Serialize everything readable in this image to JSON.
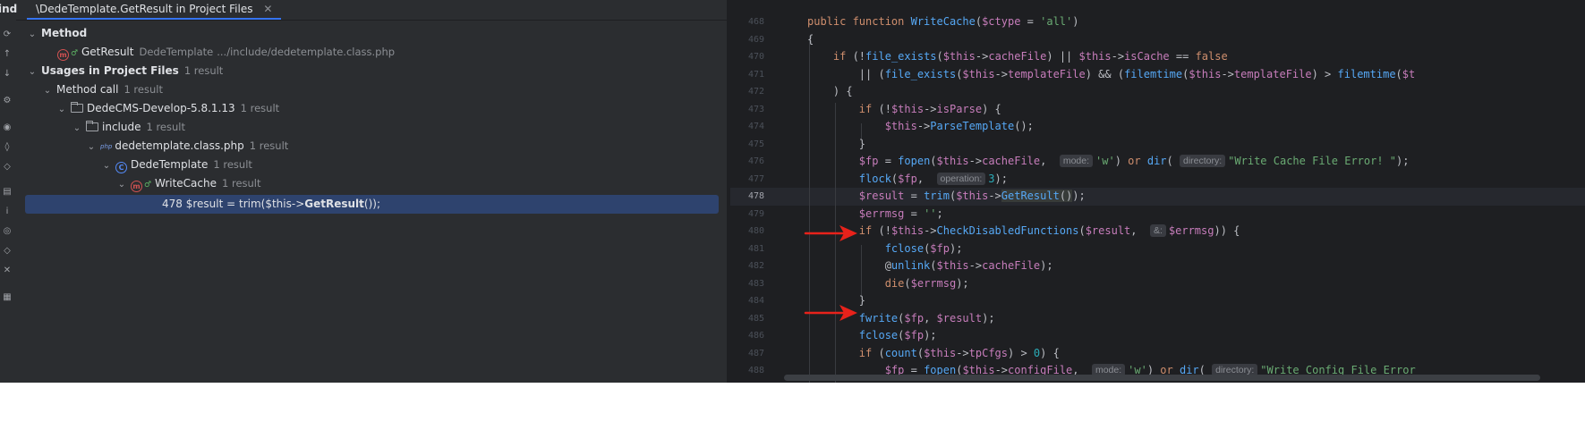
{
  "panel": {
    "title_fragment": "ind",
    "tab_label": "\\DedeTemplate.GetResult in Project Files",
    "tab_close": "✕",
    "toolbar_icons": [
      "refresh-icon",
      "up-icon",
      "down-icon",
      "settings-icon",
      "eye-icon",
      "filter-icon",
      "filter2-icon",
      "group-icon",
      "info-icon",
      "target-icon",
      "expand-icon",
      "collapse-icon",
      "preview-icon"
    ]
  },
  "tree": {
    "method_header": "Method",
    "method_name": "GetResult",
    "method_class": "DedeTemplate",
    "method_path": ".../include/dedetemplate.class.php",
    "usages_header": "Usages in Project Files",
    "usages_count": "1 result",
    "method_call": "Method call",
    "method_call_count": "1 result",
    "project": "DedeCMS-Develop-5.8.1.13",
    "project_count": "1 result",
    "include": "include",
    "include_count": "1 result",
    "file": "dedetemplate.class.php",
    "file_count": "1 result",
    "class": "DedeTemplate",
    "class_count": "1 result",
    "function": "WriteCache",
    "function_count": "1 result",
    "usage_line_no": "478",
    "usage_prefix": "$result = trim($this->",
    "usage_match": "GetResult",
    "usage_suffix": "());"
  },
  "editor": {
    "line_numbers": [
      "468",
      "469",
      "470",
      "471",
      "472",
      "473",
      "474",
      "475",
      "476",
      "477",
      "478",
      "479",
      "480",
      "481",
      "482",
      "483",
      "484",
      "485",
      "486",
      "487",
      "488"
    ],
    "current_line": "478",
    "hints": {
      "mode": "mode:",
      "directory": "directory:",
      "operation": "operation:",
      "ref": "&:"
    }
  },
  "colors": {
    "arrow": "#e8221b",
    "selection": "#2e436e",
    "keyword": "#cf8e6d",
    "variable": "#c77dbb",
    "function": "#56a8f5",
    "string": "#6aab73"
  }
}
